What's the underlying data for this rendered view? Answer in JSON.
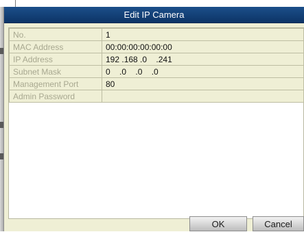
{
  "dialog": {
    "title": "Edit IP Camera"
  },
  "fields": [
    {
      "label": "No.",
      "value": "1"
    },
    {
      "label": "MAC Address",
      "value": "00:00:00:00:00:00"
    },
    {
      "label": "IP Address",
      "value": "192 .168 .0    .241"
    },
    {
      "label": "Subnet Mask",
      "value": "0    .0    .0    .0"
    },
    {
      "label": "Management Port",
      "value": "80"
    },
    {
      "label": "Admin Password",
      "value": ""
    }
  ],
  "buttons": {
    "ok": "OK",
    "cancel": "Cancel"
  }
}
